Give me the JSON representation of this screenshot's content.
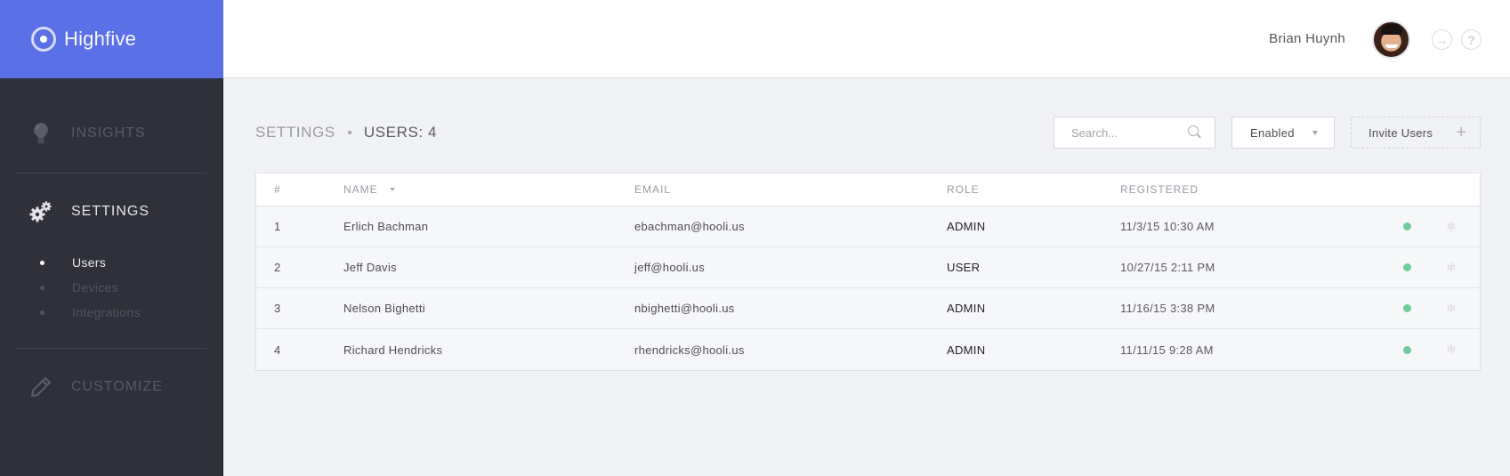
{
  "brand": {
    "name": "Highfive",
    "color": "#5b6fe6"
  },
  "sidebar": {
    "items": [
      {
        "id": "insights",
        "label": "INSIGHTS",
        "icon": "lightbulb-icon",
        "active": false
      },
      {
        "id": "settings",
        "label": "SETTINGS",
        "icon": "gears-icon",
        "active": true
      },
      {
        "id": "customize",
        "label": "CUSTOMIZE",
        "icon": "pencil-icon",
        "active": false
      }
    ],
    "subitems": [
      {
        "label": "Users",
        "active": true
      },
      {
        "label": "Devices",
        "active": false
      },
      {
        "label": "Integrations",
        "active": false
      }
    ]
  },
  "header": {
    "user_name": "Brian Huynh",
    "avatar": "user-avatar",
    "icons": [
      "logout-arrow-icon",
      "help-question-icon"
    ],
    "help_glyph": "?",
    "logout_glyph": "→"
  },
  "page": {
    "breadcrumb_parent": "SETTINGS",
    "breadcrumb_current": "USERS: 4",
    "search": {
      "placeholder": "Search...",
      "value": ""
    },
    "status_filter": {
      "selected": "Enabled"
    },
    "invite_label": "Invite Users",
    "plus_glyph": "+"
  },
  "table": {
    "columns": [
      "#",
      "NAME",
      "EMAIL",
      "ROLE",
      "REGISTERED"
    ],
    "sorted_by": "NAME",
    "status_color": "#70cc9c",
    "gear_glyph": "✻",
    "rows": [
      {
        "num": "1",
        "name": "Erlich Bachman",
        "email": "ebachman@hooli.us",
        "role": "ADMIN",
        "registered": "11/3/15 10:30 AM",
        "status": "enabled"
      },
      {
        "num": "2",
        "name": "Jeff Davis",
        "email": "jeff@hooli.us",
        "role": "USER",
        "registered": "10/27/15 2:11 PM",
        "status": "enabled"
      },
      {
        "num": "3",
        "name": "Nelson Bighetti",
        "email": "nbighetti@hooli.us",
        "role": "ADMIN",
        "registered": "11/16/15 3:38 PM",
        "status": "enabled"
      },
      {
        "num": "4",
        "name": "Richard Hendricks",
        "email": "rhendricks@hooli.us",
        "role": "ADMIN",
        "registered": "11/11/15 9:28 AM",
        "status": "enabled"
      }
    ]
  }
}
